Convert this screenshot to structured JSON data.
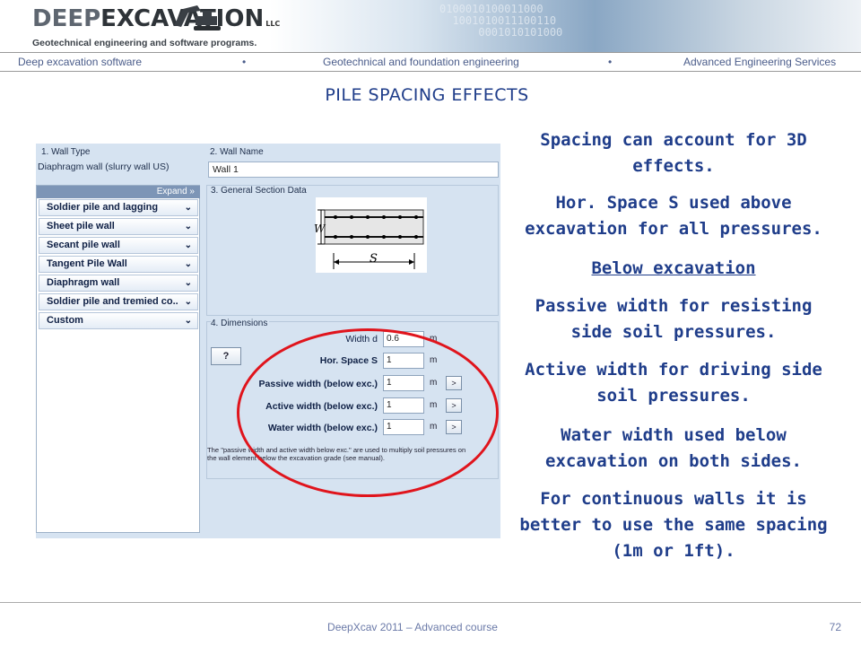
{
  "header": {
    "logo_deep": "DEEP",
    "logo_excavation": "EXCAVATION",
    "logo_llc": "LLC",
    "tagline": "Geotechnical engineering and software programs."
  },
  "nav": {
    "items": [
      "Deep excavation software",
      "Geotechnical and foundation engineering",
      "Advanced Engineering Services"
    ],
    "separator": "•"
  },
  "slide_title": "PILE SPACING EFFECTS",
  "dialog": {
    "wall_type_header": "1. Wall Type",
    "wall_type_value": "Diaphragm wall (slurry wall US)",
    "expand_label": "Expand »",
    "wall_types": [
      "Soldier pile and lagging",
      "Sheet pile wall",
      "Secant pile wall",
      "Tangent Pile Wall",
      "Diaphragm wall",
      "Soldier pile and tremied co..",
      "Custom"
    ],
    "wall_name_header": "2. Wall Name",
    "wall_name_value": "Wall 1",
    "general_section_header": "3. General Section Data",
    "diagram_label_w": "W",
    "diagram_label_s": "S",
    "dimensions_header": "4. Dimensions",
    "help_button": "?",
    "fields": [
      {
        "label": "Width d",
        "value": "0.6",
        "unit": "m",
        "has_button": false
      },
      {
        "label": "Hor. Space S",
        "value": "1",
        "unit": "m",
        "has_button": false
      },
      {
        "label": "Passive width (below exc.)",
        "value": "1",
        "unit": "m",
        "has_button": true
      },
      {
        "label": "Active width (below exc.)",
        "value": "1",
        "unit": "m",
        "has_button": true
      },
      {
        "label": "Water width (below exc.)",
        "value": "1",
        "unit": "m",
        "has_button": true
      }
    ],
    "field_button_label": ">",
    "note": "The \"passive width and active width below exc.\" are used to multiply soil pressures on the wall element below the excavation grade (see manual)."
  },
  "right_text": [
    "Spacing can account for 3D effects.",
    "Hor. Space S used above excavation for all pressures.",
    "Below excavation",
    "Passive width for resisting side soil pressures.",
    "Active width for driving side soil pressures.",
    "Water width used below excavation on both sides.",
    "For continuous walls it is better to use the same spacing (1m or 1ft)."
  ],
  "footer": {
    "course": "DeepXcav 2011 – Advanced course",
    "page": "72"
  },
  "colors": {
    "title_blue": "#1f3d8a",
    "highlight_red": "#e0141c",
    "panel_blue": "#d6e3f1"
  }
}
